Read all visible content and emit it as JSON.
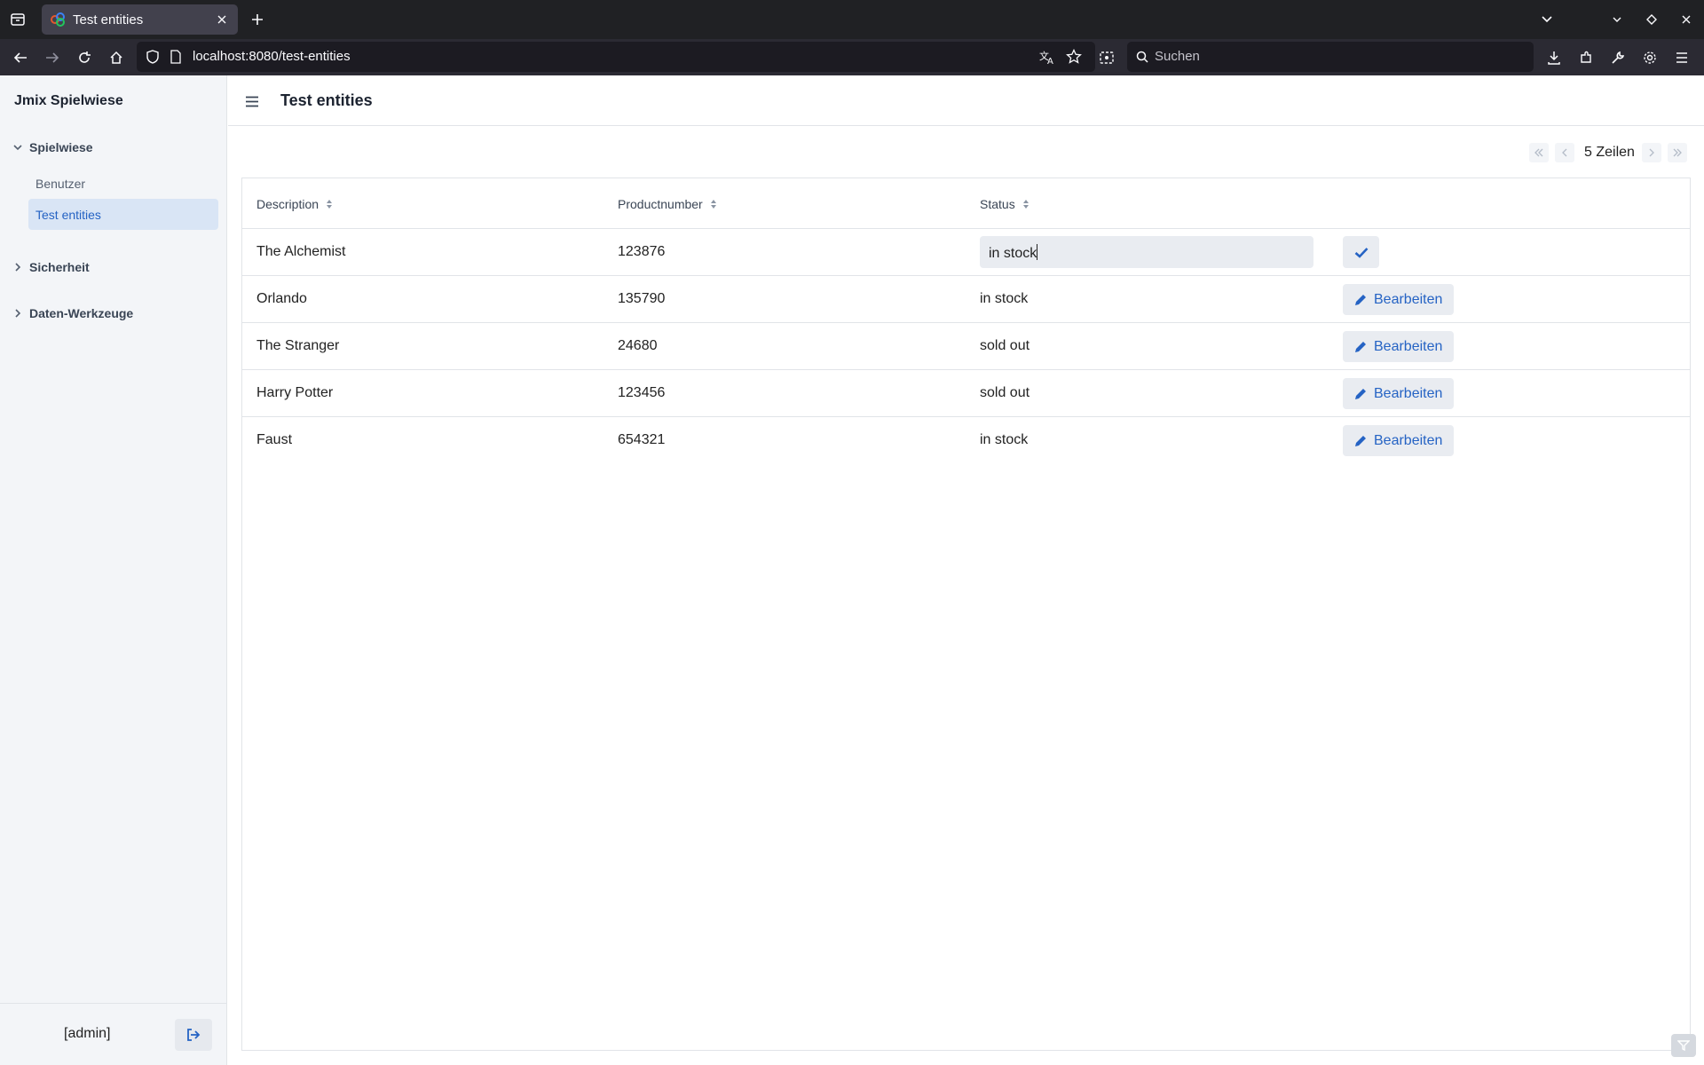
{
  "browser": {
    "tab_title": "Test entities",
    "url": "localhost:8080/test-entities",
    "search_placeholder": "Suchen"
  },
  "app": {
    "name": "Jmix Spielwiese",
    "page_title": "Test entities",
    "user_label": "[admin]"
  },
  "sidebar": {
    "groups": [
      {
        "label": "Spielwiese",
        "expanded": true,
        "items": [
          {
            "label": "Benutzer",
            "active": false
          },
          {
            "label": "Test entities",
            "active": true
          }
        ]
      },
      {
        "label": "Sicherheit",
        "expanded": false
      },
      {
        "label": "Daten-Werkzeuge",
        "expanded": false
      }
    ]
  },
  "pagination": {
    "label": "5 Zeilen"
  },
  "grid": {
    "columns": [
      "Description",
      "Productnumber",
      "Status"
    ],
    "edit_label": "Bearbeiten",
    "rows": [
      {
        "description": "The Alchemist",
        "productnumber": "123876",
        "status": "in stock",
        "editing": true
      },
      {
        "description": "Orlando",
        "productnumber": "135790",
        "status": "in stock"
      },
      {
        "description": "The Stranger",
        "productnumber": "24680",
        "status": "sold out"
      },
      {
        "description": "Harry Potter",
        "productnumber": "123456",
        "status": "sold out"
      },
      {
        "description": "Faust",
        "productnumber": "654321",
        "status": "in stock"
      }
    ]
  },
  "colors": {
    "accent": "#2563c4",
    "sidebar_bg": "#f3f5f8",
    "active_item_bg": "#d9e5f5"
  }
}
